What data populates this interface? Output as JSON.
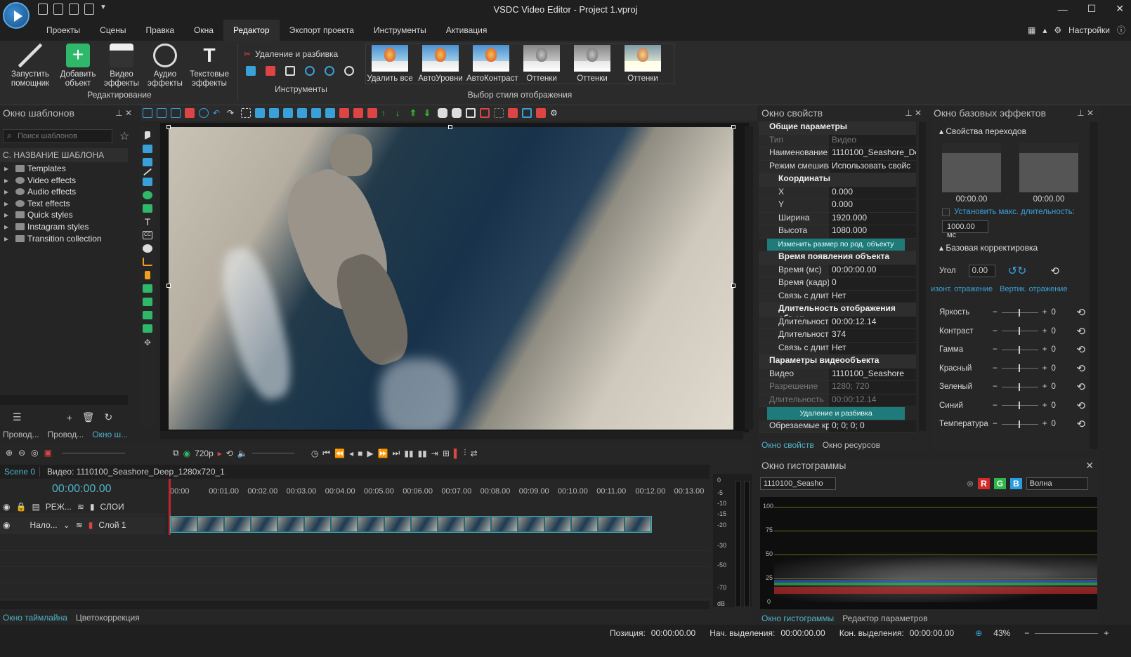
{
  "app": {
    "title": "VSDC Video Editor - Project 1.vproj"
  },
  "menu": {
    "items": [
      "Проекты",
      "Сцены",
      "Правка",
      "Окна",
      "Редактор",
      "Экспорт проекта",
      "Инструменты",
      "Активация"
    ],
    "active": "Редактор",
    "settings": "Настройки"
  },
  "ribbon": {
    "wizard": "Запустить помощник",
    "add_object": "Добавить объект",
    "video_effects": "Видео эффекты",
    "audio_effects": "Аудио эффекты",
    "text_effects": "Текстовые эффекты",
    "group_edit": "Редактирование",
    "cut_split": "Удаление и разбивка",
    "group_tools": "Инструменты",
    "styles": [
      "Удалить все",
      "АвтоУровни",
      "АвтоКонтраст",
      "Оттенки",
      "Оттенки",
      "Оттенки"
    ],
    "group_styles": "Выбор стиля отображения"
  },
  "templates": {
    "title": "Окно шаблонов",
    "search_placeholder": "Поиск шаблонов",
    "column": "С. НАЗВАНИЕ ШАБЛОНА",
    "items": [
      "Templates",
      "Video effects",
      "Audio effects",
      "Text effects",
      "Quick styles",
      "Instagram styles",
      "Transition collection"
    ],
    "tabs": [
      "Провод...",
      "Провод...",
      "Окно ш..."
    ]
  },
  "properties": {
    "title": "Окно свойств",
    "general": "Общие параметры",
    "type_k": "Тип",
    "type_v": "Видео",
    "name_k": "Наименование",
    "name_v": "1110100_Seashore_De",
    "blend_k": "Режим смешиван",
    "blend_v": "Использовать свойс",
    "coords": "Координаты",
    "x_k": "X",
    "x_v": "0.000",
    "y_k": "Y",
    "y_v": "0.000",
    "w_k": "Ширина",
    "w_v": "1920.000",
    "h_k": "Высота",
    "h_v": "1080.000",
    "resize_btn": "Изменить размер по род. объекту",
    "appear": "Время появления объекта",
    "tms_k": "Время (мс)",
    "tms_v": "00:00:00.00",
    "tfr_k": "Время (кадр)",
    "tfr_v": "0",
    "link_k": "Связь с длител",
    "link_v": "Нет",
    "dur": "Длительность отображения объек",
    "d1_k": "Длительность (",
    "d1_v": "00:00:12.14",
    "d2_k": "Длительность (",
    "d2_v": "374",
    "link2_k": "Связь с длител",
    "link2_v": "Нет",
    "vparams": "Параметры видеообъекта",
    "video_k": "Видео",
    "video_v": "1110100_Seashore",
    "res_k": "Разрешение",
    "res_v": "1280; 720",
    "len_k": "Длительность",
    "len_v": "00:00:12.14",
    "cut_btn": "Удаление и разбивка",
    "crop_k": "Обрезаемые края",
    "crop_v": "0; 0; 0; 0",
    "tabs": [
      "Окно свойств",
      "Окно ресурсов"
    ]
  },
  "basic": {
    "title": "Окно базовых эффектов",
    "transitions": "Свойства переходов",
    "t1": "00:00.00",
    "t2": "00:00.00",
    "maxdur": "Установить макс. длительность:",
    "ms": "1000.00 мс",
    "correction": "Базовая корректировка",
    "angle": "Угол",
    "angle_v": "0.00",
    "hflip": "изонт. отражение",
    "vflip": "Вертик. отражение",
    "sliders": [
      {
        "l": "Яркость",
        "v": "0"
      },
      {
        "l": "Контраст",
        "v": "0"
      },
      {
        "l": "Гамма",
        "v": "0"
      },
      {
        "l": "Красный",
        "v": "0"
      },
      {
        "l": "Зеленый",
        "v": "0"
      },
      {
        "l": "Синий",
        "v": "0"
      },
      {
        "l": "Температура",
        "v": "0"
      }
    ]
  },
  "histogram": {
    "title": "Окно гистограммы",
    "source": "1110100_Seasho",
    "mode": "Волна",
    "r": "R",
    "g": "G",
    "b": "B",
    "scale": [
      "100",
      "75",
      "50",
      "25",
      "0"
    ],
    "tabs": [
      "Окно гистограммы",
      "Редактор параметров"
    ]
  },
  "timeline": {
    "scene": "Scene 0",
    "clip_title": "Видео: 1110100_Seashore_Deep_1280x720_1",
    "time": "00:00:00.00",
    "res": "720p",
    "mode_label": "РЕЖ...",
    "layers_label": "СЛОИ",
    "blend": "Нало...",
    "layer": "Слой 1",
    "ticks": [
      "00:00",
      "00:01.00",
      "00:02.00",
      "00:03.00",
      "00:04.00",
      "00:05.00",
      "00:06.00",
      "00:07.00",
      "00:08.00",
      "00:09.00",
      "00:10.00",
      "00:11.00",
      "00:12.00",
      "00:13.00"
    ],
    "db": [
      "0",
      "-5",
      "-10",
      "-15",
      "-20",
      "-30",
      "-50",
      "-70",
      "dB"
    ],
    "tabs": [
      "Окно таймлайна",
      "Цветокоррекция"
    ]
  },
  "status": {
    "pos_label": "Позиция:",
    "pos": "00:00:00.00",
    "sel_start_label": "Нач. выделения:",
    "sel_start": "00:00:00.00",
    "sel_end_label": "Кон. выделения:",
    "sel_end": "00:00:00.00",
    "zoom": "43%"
  }
}
